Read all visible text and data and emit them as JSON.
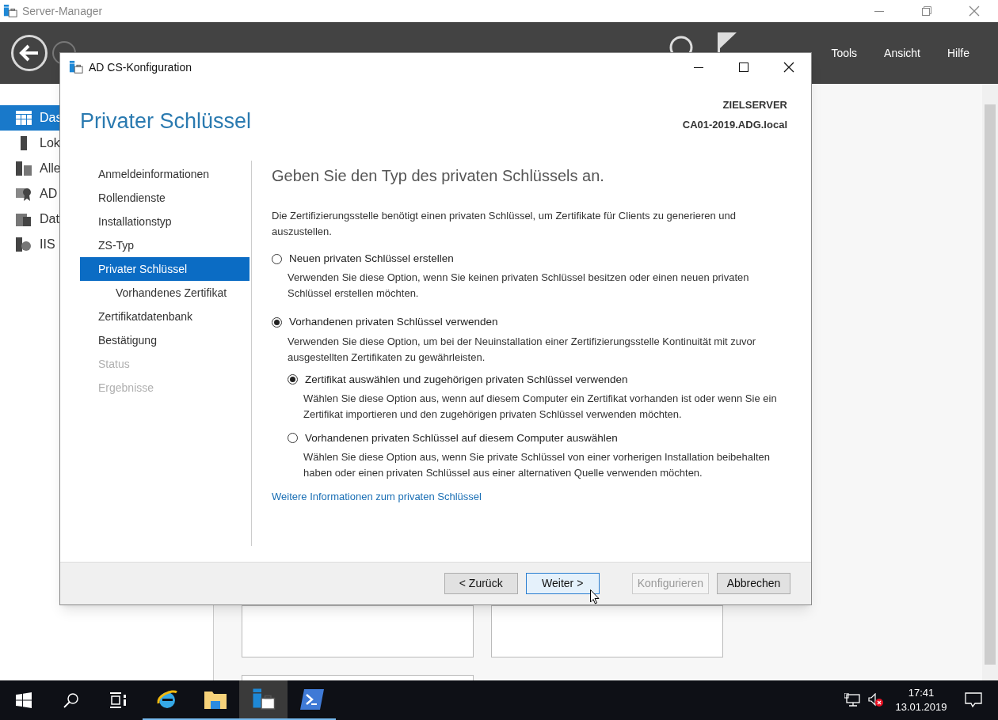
{
  "window": {
    "title": "Server-Manager"
  },
  "header": {
    "menu": [
      {
        "label": "Tools"
      },
      {
        "label": "Ansicht"
      },
      {
        "label": "Hilfe"
      }
    ]
  },
  "sidebar": {
    "items": [
      {
        "label": "Das",
        "kind": "dashboard",
        "selected": true
      },
      {
        "label": "Lok",
        "kind": "server",
        "selected": false
      },
      {
        "label": "Alle",
        "kind": "servers",
        "selected": false
      },
      {
        "label": "AD",
        "kind": "certificate",
        "selected": false
      },
      {
        "label": "Dat",
        "kind": "files",
        "selected": false
      },
      {
        "label": "IIS",
        "kind": "iis",
        "selected": false
      }
    ]
  },
  "dialog": {
    "title": "AD CS-Konfiguration",
    "heading": "Privater Schlüssel",
    "target_label": "ZIELSERVER",
    "target_server": "CA01-2019.ADG.local",
    "nav": [
      {
        "label": "Anmeldeinformationen",
        "selected": false,
        "disabled": false
      },
      {
        "label": "Rollendienste",
        "selected": false,
        "disabled": false
      },
      {
        "label": "Installationstyp",
        "selected": false,
        "disabled": false
      },
      {
        "label": "ZS-Typ",
        "selected": false,
        "disabled": false
      },
      {
        "label": "Privater Schlüssel",
        "selected": true,
        "disabled": false,
        "children": [
          {
            "label": "Vorhandenes Zertifikat",
            "selected": false,
            "disabled": false
          }
        ]
      },
      {
        "label": "Zertifikatdatenbank",
        "selected": false,
        "disabled": false
      },
      {
        "label": "Bestätigung",
        "selected": false,
        "disabled": false
      },
      {
        "label": "Status",
        "selected": false,
        "disabled": true
      },
      {
        "label": "Ergebnisse",
        "selected": false,
        "disabled": true
      }
    ],
    "content": {
      "title": "Geben Sie den Typ des privaten Schlüssels an.",
      "intro": "Die Zertifizierungsstelle benötigt einen privaten Schlüssel, um Zertifikate für Clients zu generieren und auszustellen.",
      "options": [
        {
          "label": "Neuen privaten Schlüssel erstellen",
          "description": "Verwenden Sie diese Option, wenn Sie keinen privaten Schlüssel besitzen oder einen neuen privaten Schlüssel erstellen möchten.",
          "selected": false
        },
        {
          "label": "Vorhandenen privaten Schlüssel verwenden",
          "description": "Verwenden Sie diese Option, um bei der Neuinstallation einer Zertifizierungsstelle Kontinuität mit zuvor ausgestellten Zertifikaten zu gewährleisten.",
          "selected": true,
          "children": [
            {
              "label": "Zertifikat auswählen und zugehörigen privaten Schlüssel verwenden",
              "description": "Wählen Sie diese Option aus, wenn auf diesem Computer ein Zertifikat vorhanden ist oder wenn Sie ein Zertifikat importieren und den zugehörigen privaten Schlüssel verwenden möchten.",
              "selected": true
            },
            {
              "label": "Vorhandenen privaten Schlüssel auf diesem Computer auswählen",
              "description": "Wählen Sie diese Option aus, wenn Sie private Schlüssel von einer vorherigen Installation beibehalten haben oder einen privaten Schlüssel aus einer alternativen Quelle verwenden möchten.",
              "selected": false
            }
          ]
        }
      ],
      "link": "Weitere Informationen zum privaten Schlüssel"
    },
    "buttons": [
      {
        "label": "< Zurück",
        "disabled": false,
        "focused": false
      },
      {
        "label": "Weiter >",
        "disabled": false,
        "focused": true
      },
      {
        "label": "Konfigurieren",
        "disabled": true,
        "focused": false
      },
      {
        "label": "Abbrechen",
        "disabled": false,
        "focused": false
      }
    ]
  },
  "taskbar": {
    "apps": [
      {
        "kind": "browser",
        "selected": false
      },
      {
        "kind": "folder",
        "selected": false
      },
      {
        "kind": "server-manager",
        "selected": true
      },
      {
        "kind": "terminal",
        "selected": false
      }
    ],
    "time": "17:41",
    "date": "13.01.2019"
  }
}
